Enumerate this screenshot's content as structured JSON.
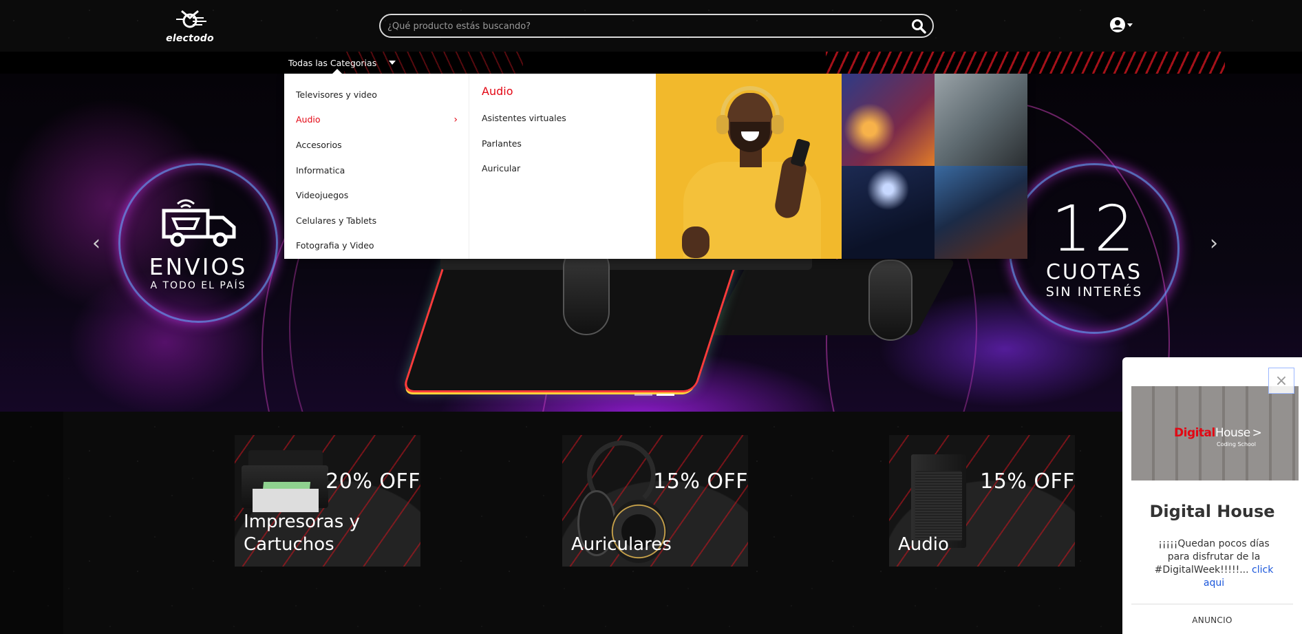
{
  "header": {
    "logo_text": "electodo",
    "search": {
      "placeholder": "¿Qué producto estás buscando?",
      "value": ""
    }
  },
  "catbar": {
    "all_categories_label": "Todas las Categorias"
  },
  "mega_menu": {
    "categories": [
      {
        "label": "Televisores y video"
      },
      {
        "label": "Audio"
      },
      {
        "label": "Accesorios"
      },
      {
        "label": "Informatica"
      },
      {
        "label": "Videojuegos"
      },
      {
        "label": "Celulares y Tablets"
      },
      {
        "label": "Fotografia y Video"
      }
    ],
    "active_index": 1,
    "active_heading": "Audio",
    "subcategories": [
      {
        "label": "Asistentes virtuales"
      },
      {
        "label": "Parlantes"
      },
      {
        "label": "Auricular"
      }
    ]
  },
  "hero": {
    "left_badge": {
      "title": "ENVIOS",
      "subtitle": "A TODO EL PAÍS"
    },
    "right_badge": {
      "number": "12",
      "title": "CUOTAS",
      "subtitle": "SIN INTERÉS"
    },
    "slides_count": 2,
    "active_slide": 2
  },
  "promos": [
    {
      "discount": "20% OFF",
      "title": "Impresoras y Cartuchos"
    },
    {
      "discount": "15% OFF",
      "title": "Auriculares"
    },
    {
      "discount": "15% OFF",
      "title": "Audio"
    }
  ],
  "ad": {
    "image_brand_red": "Digital",
    "image_brand_white": "House",
    "image_brand_suffix": ">",
    "image_brand_sub": "Coding School",
    "title": "Digital House",
    "body": "¡¡¡¡¡Quedan pocos días para disfrutar de la #DigitalWeek!!!!!...",
    "link": "click aqui",
    "label": "ANUNCIO"
  },
  "colors": {
    "accent_red": "#e30613",
    "link_blue": "#1a56db",
    "header_bg": "#0b0b0b"
  }
}
